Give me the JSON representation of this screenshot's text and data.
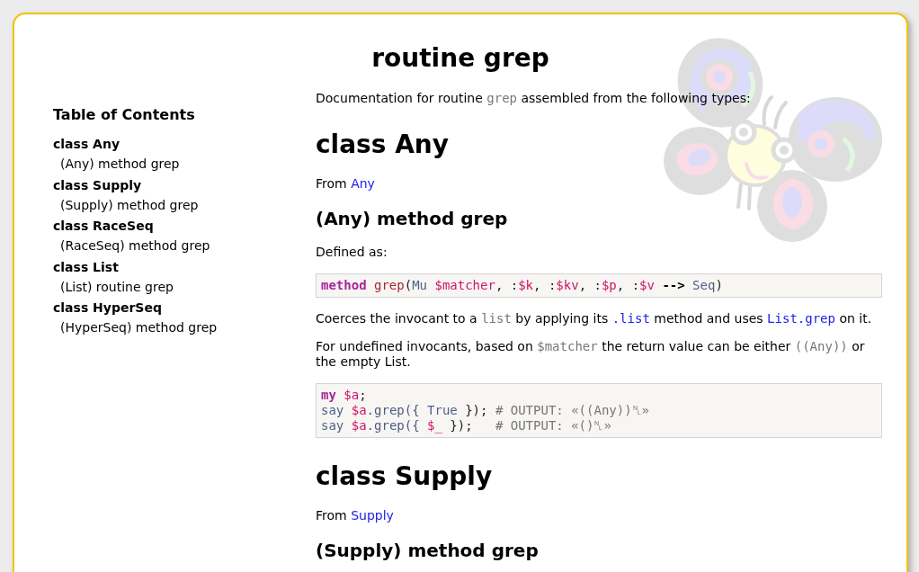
{
  "page": {
    "title": "routine grep"
  },
  "toc": {
    "title": "Table of Contents",
    "items": [
      {
        "label": "class Any",
        "children": [
          {
            "label": "(Any) method grep"
          }
        ]
      },
      {
        "label": "class Supply",
        "children": [
          {
            "label": "(Supply) method grep"
          }
        ]
      },
      {
        "label": "class RaceSeq",
        "children": [
          {
            "label": "(RaceSeq) method grep"
          }
        ]
      },
      {
        "label": "class List",
        "children": [
          {
            "label": "(List) routine grep"
          }
        ]
      },
      {
        "label": "class HyperSeq",
        "children": [
          {
            "label": "(HyperSeq) method grep"
          }
        ]
      }
    ]
  },
  "intro": [
    {
      "kind": "text",
      "text": "Documentation for routine "
    },
    {
      "kind": "code",
      "text": "grep"
    },
    {
      "kind": "text",
      "text": " assembled from the following types:"
    }
  ],
  "sections": [
    {
      "heading": "class Any",
      "blocks": [
        {
          "kind": "paragraph",
          "segments": [
            {
              "kind": "text",
              "text": "From "
            },
            {
              "kind": "link",
              "text": "Any"
            }
          ]
        },
        {
          "kind": "heading",
          "text": "(Any) method grep"
        },
        {
          "kind": "paragraph",
          "segments": [
            {
              "kind": "text",
              "text": "Defined as:"
            }
          ]
        },
        {
          "kind": "code",
          "lines": [
            [
              {
                "kind": "keyword",
                "text": "method"
              },
              {
                "kind": "function",
                "text": " grep"
              },
              {
                "kind": "plain",
                "text": "("
              },
              {
                "kind": "type",
                "text": "Mu"
              },
              {
                "kind": "variable",
                "text": " $matcher"
              },
              {
                "kind": "plain",
                "text": ", :"
              },
              {
                "kind": "variable",
                "text": "$k"
              },
              {
                "kind": "plain",
                "text": ", :"
              },
              {
                "kind": "variable",
                "text": "$kv"
              },
              {
                "kind": "plain",
                "text": ", :"
              },
              {
                "kind": "variable",
                "text": "$p"
              },
              {
                "kind": "plain",
                "text": ", :"
              },
              {
                "kind": "variable",
                "text": "$v"
              },
              {
                "kind": "operator",
                "text": " --> "
              },
              {
                "kind": "type",
                "text": "Seq"
              },
              {
                "kind": "plain",
                "text": ")"
              }
            ]
          ]
        },
        {
          "kind": "paragraph",
          "segments": [
            {
              "kind": "text",
              "text": "Coerces the invocant to a "
            },
            {
              "kind": "code",
              "text": "list"
            },
            {
              "kind": "text",
              "text": " by applying its "
            },
            {
              "kind": "code-link",
              "text": ".list"
            },
            {
              "kind": "text",
              "text": " method and uses "
            },
            {
              "kind": "code-link",
              "text": "List.grep"
            },
            {
              "kind": "text",
              "text": " on it."
            }
          ]
        },
        {
          "kind": "paragraph",
          "segments": [
            {
              "kind": "text",
              "text": "For undefined invocants, based on "
            },
            {
              "kind": "code",
              "text": "$matcher"
            },
            {
              "kind": "text",
              "text": " the return value can be either "
            },
            {
              "kind": "code",
              "text": "((Any))"
            },
            {
              "kind": "text",
              "text": " or the empty List."
            }
          ]
        },
        {
          "kind": "code",
          "lines": [
            [
              {
                "kind": "keyword",
                "text": "my"
              },
              {
                "kind": "variable",
                "text": " $a"
              },
              {
                "kind": "plain",
                "text": ";"
              }
            ],
            [
              {
                "kind": "type",
                "text": "say"
              },
              {
                "kind": "variable",
                "text": " $a"
              },
              {
                "kind": "method",
                "text": ".grep({ "
              },
              {
                "kind": "type",
                "text": "True"
              },
              {
                "kind": "plain",
                "text": " });"
              },
              {
                "kind": "comment",
                "text": " # OUTPUT: «((Any))␤»"
              }
            ],
            [
              {
                "kind": "type",
                "text": "say"
              },
              {
                "kind": "variable",
                "text": " $a"
              },
              {
                "kind": "method",
                "text": ".grep({ "
              },
              {
                "kind": "variable",
                "text": "$_"
              },
              {
                "kind": "plain",
                "text": " });"
              },
              {
                "kind": "comment",
                "text": "   # OUTPUT: «()␤»"
              }
            ]
          ]
        }
      ]
    },
    {
      "heading": "class Supply",
      "blocks": [
        {
          "kind": "paragraph",
          "segments": [
            {
              "kind": "text",
              "text": "From "
            },
            {
              "kind": "link",
              "text": "Supply"
            }
          ]
        },
        {
          "kind": "heading",
          "text": "(Supply) method grep"
        }
      ]
    }
  ]
}
